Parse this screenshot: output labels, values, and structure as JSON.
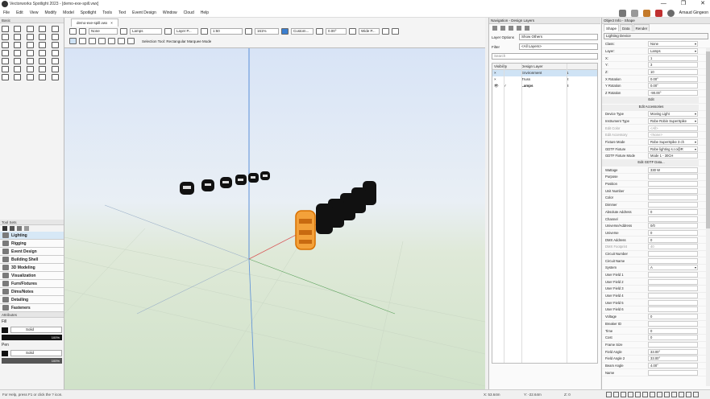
{
  "window": {
    "title": "Vectorworks Spotlight 2023 - [demo-exe-spill.vwx]",
    "controls": [
      "—",
      "❐",
      "✕"
    ]
  },
  "menu": [
    "File",
    "Edit",
    "View",
    "Modify",
    "Model",
    "Spotlight",
    "Tools",
    "Text",
    "Event Design",
    "Window",
    "Cloud",
    "Help"
  ],
  "user": {
    "name": "Arnaud Gingeon"
  },
  "left": {
    "basic_title": "Basic",
    "toolsets_title": "Tool Sets",
    "toolsets": [
      "Lighting",
      "Rigging",
      "Event Design",
      "Building Shell",
      "3D Modeling",
      "Visualization",
      "Furn/Fixtures",
      "Dims/Notes",
      "Detailing",
      "Fasteners"
    ],
    "attributes_title": "Attributes",
    "fill_label": "Fill",
    "fill_style": "Solid",
    "fill_opacity": "100%",
    "pen_label": "Pen",
    "pen_style": "Solid",
    "pen_opacity": "100%"
  },
  "doc": {
    "tab": "demo-exe-spill.vwx",
    "tab_close": "×",
    "class_value": "None",
    "layer_value": "Lamps",
    "layer_plane": "Layer P...",
    "scale": "1:50",
    "zoom": "161%",
    "render": "Custom...",
    "angle": "0.00°",
    "view": "Wide P...",
    "tool_hint": "Selection Tool: Rectangular Marquee Mode"
  },
  "status": {
    "left": "For Help, press F1 or click the ? icon.",
    "x": "X: 53.64m",
    "y": "Y: -22.64m",
    "z": "Z: 0"
  },
  "nav": {
    "title": "Navigation - Design Layers",
    "layer_options_label": "Layer Options",
    "layer_options_value": "Show Others",
    "filter_label": "Filter",
    "filter_value": "<All Layers>",
    "search_placeholder": "Search",
    "cols": [
      "Visibility",
      "",
      "Design Layer",
      ""
    ],
    "rows": [
      {
        "vis": "×",
        "chk": "",
        "name": "Environment",
        "num": "1"
      },
      {
        "vis": "×",
        "chk": "",
        "name": "Truss",
        "num": "2"
      },
      {
        "vis": "👁",
        "chk": "✓",
        "name": "Lamps",
        "num": "3"
      }
    ]
  },
  "oi": {
    "title": "Object Info - Shape",
    "tabs": [
      "Shape",
      "Data",
      "Render"
    ],
    "object_type": "Lighting Device",
    "props": [
      {
        "l": "Class:",
        "v": "None",
        "t": "dd"
      },
      {
        "l": "Layer:",
        "v": "Lamps",
        "t": "dd"
      },
      {
        "l": "X:",
        "v": "1"
      },
      {
        "l": "Y:",
        "v": "3"
      },
      {
        "l": "Z:",
        "v": "10"
      },
      {
        "l": "X Rotation",
        "v": "0.00°"
      },
      {
        "l": "Y Rotation",
        "v": "0.00°"
      },
      {
        "l": "Z Rotation",
        "v": "-90.00°"
      },
      {
        "l": "",
        "v": "Edit",
        "t": "btn"
      },
      {
        "l": "",
        "v": "Edit Accessories",
        "t": "btn"
      },
      {
        "l": "Device Type",
        "v": "Moving Light",
        "t": "dd"
      },
      {
        "l": "Instrument Type",
        "v": "Robe Robin SuperSpike",
        "t": "dd"
      },
      {
        "l": "Edit Color",
        "v": "<All>",
        "t": "dim"
      },
      {
        "l": "Edit Accessory",
        "v": "<None>",
        "t": "dim"
      },
      {
        "l": "Fixture Mode",
        "v": "Robe SuperSpike 3 ch",
        "t": "dd"
      },
      {
        "l": "GDTF Fixture",
        "v": "Robe lighting s.r.o@R",
        "t": "dd"
      },
      {
        "l": "GDTF Fixture Mode",
        "v": "Mode 1 - 30CH"
      },
      {
        "l": "",
        "v": "Edit GDTF Data...",
        "t": "btn"
      },
      {
        "l": "Wattage",
        "v": "330 W"
      },
      {
        "l": "Purpose",
        "v": ""
      },
      {
        "l": "Position",
        "v": ""
      },
      {
        "l": "Unit Number",
        "v": ""
      },
      {
        "l": "Color",
        "v": ""
      },
      {
        "l": "Dimmer",
        "v": ""
      },
      {
        "l": "Absolute Address",
        "v": "0"
      },
      {
        "l": "Channel",
        "v": ""
      },
      {
        "l": "Universe/Address",
        "v": "0/0"
      },
      {
        "l": "Universe",
        "v": "0"
      },
      {
        "l": "DMX Address",
        "v": "0"
      },
      {
        "l": "DMX Footprint",
        "v": "40",
        "t": "dim"
      },
      {
        "l": "Circuit Number",
        "v": ""
      },
      {
        "l": "Circuit Name",
        "v": ""
      },
      {
        "l": "System",
        "v": "A",
        "t": "dd"
      },
      {
        "l": "User Field 1",
        "v": ""
      },
      {
        "l": "User Field 2",
        "v": ""
      },
      {
        "l": "User Field 3",
        "v": ""
      },
      {
        "l": "User Field 4",
        "v": ""
      },
      {
        "l": "User Field 5",
        "v": ""
      },
      {
        "l": "User Field 6",
        "v": ""
      },
      {
        "l": "Voltage",
        "v": "0"
      },
      {
        "l": "Breaker ID",
        "v": ""
      },
      {
        "l": "Time",
        "v": "0"
      },
      {
        "l": "Cost",
        "v": "0"
      },
      {
        "l": "Frame Size",
        "v": ""
      },
      {
        "l": "Field Angle",
        "v": "33.00°"
      },
      {
        "l": "Field Angle 2",
        "v": "33.00°"
      },
      {
        "l": "Beam Angle",
        "v": "4.00°"
      },
      {
        "l": "Name",
        "v": ""
      }
    ]
  },
  "colors": {
    "accent": "#0078d4",
    "selection": "#f08010",
    "fixture": "#111111",
    "axis_blue": "#5a8fd8",
    "axis_red": "#d85a5a",
    "axis_green": "#5aa05a"
  }
}
